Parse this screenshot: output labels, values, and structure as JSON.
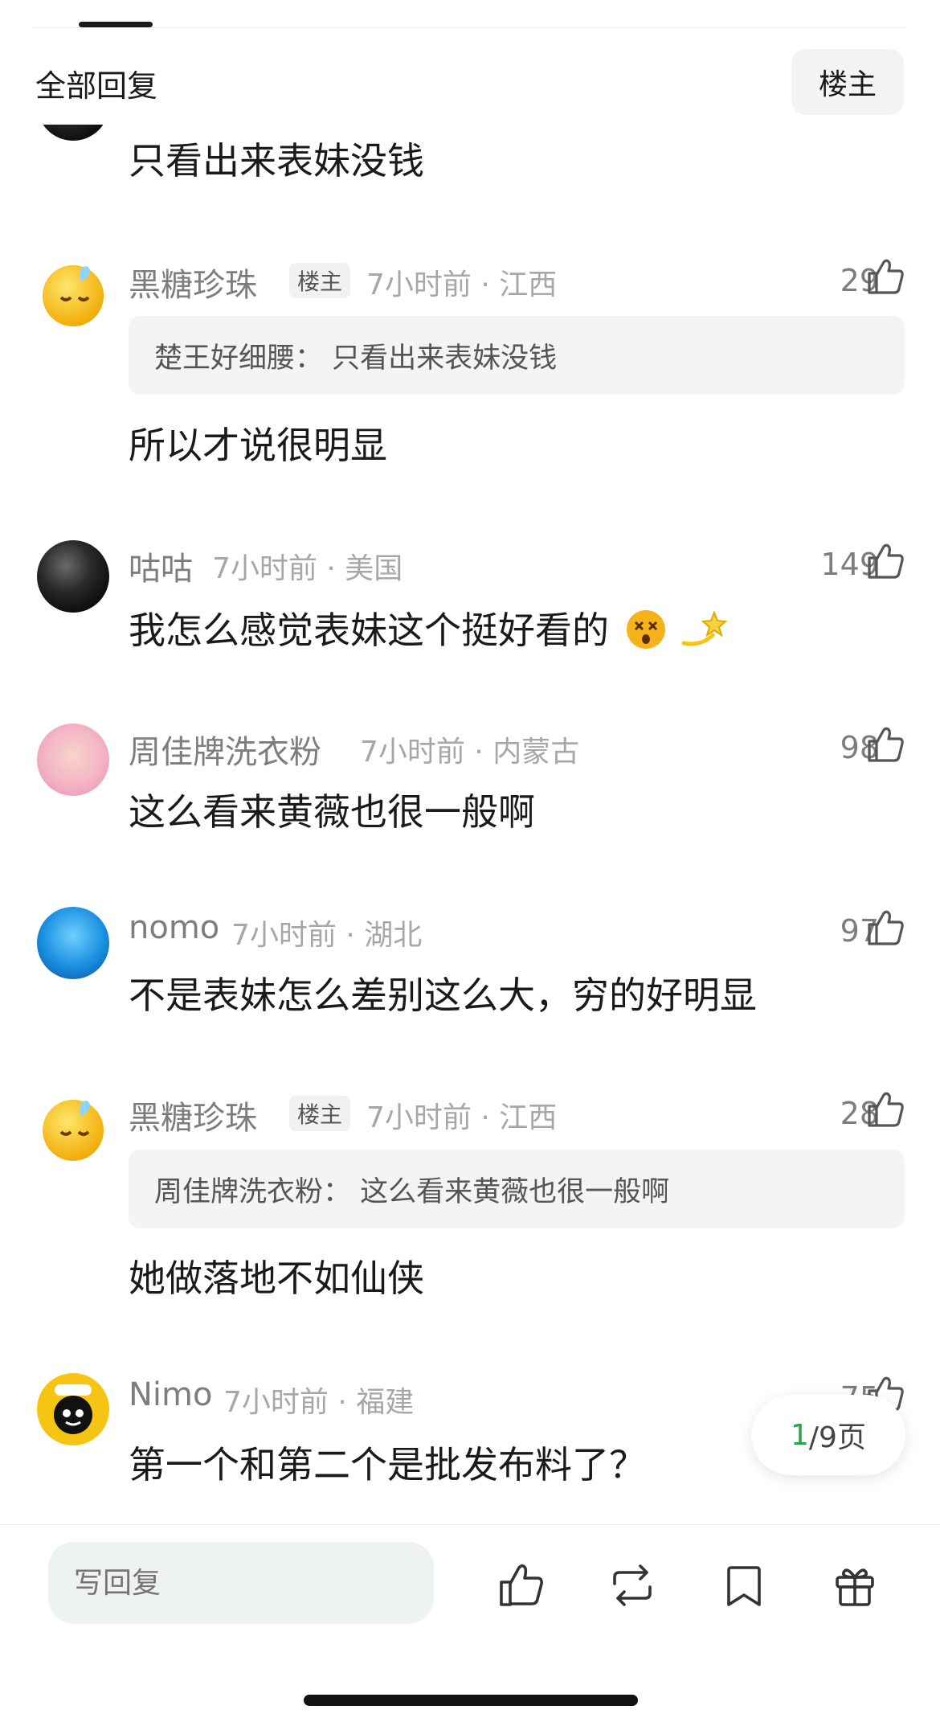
{
  "header": {
    "title": "全部回复",
    "op_filter_label": "楼主"
  },
  "comments": [
    {
      "content": "只看出来表妹没钱"
    },
    {
      "name": "黑糖珍珠",
      "badge": "楼主",
      "meta": "7小时前 · 江西",
      "likes": "29",
      "quote": "楚王好细腰：  只看出来表妹没钱",
      "content": "所以才说很明显"
    },
    {
      "name": "咕咕",
      "meta": "7小时前 · 美国",
      "likes": "149",
      "content": "我怎么感觉表妹这个挺好看的"
    },
    {
      "name": "周佳牌洗衣粉",
      "meta": "7小时前 · 内蒙古",
      "likes": "98",
      "content": "这么看来黄薇也很一般啊"
    },
    {
      "name": "nomo",
      "meta": "7小时前 · 湖北",
      "likes": "97",
      "content": "不是表妹怎么差别这么大，穷的好明显"
    },
    {
      "name": "黑糖珍珠",
      "badge": "楼主",
      "meta": "7小时前 · 江西",
      "likes": "28",
      "quote": "周佳牌洗衣粉：  这么看来黄薇也很一般啊",
      "content": "她做落地不如仙侠"
    },
    {
      "name": "Nimo",
      "meta": "7小时前 · 福建",
      "likes": "75",
      "content": "第一个和第二个是批发布料了？"
    }
  ],
  "pagination": {
    "current": "1",
    "total_text": "/9页"
  },
  "bottom_bar": {
    "reply_placeholder": "写回复"
  },
  "colors": {
    "accent_green": "#2ea34a",
    "muted": "#7d7d7d"
  },
  "icons": [
    "like-icon",
    "repost-icon",
    "bookmark-icon",
    "gift-icon"
  ]
}
